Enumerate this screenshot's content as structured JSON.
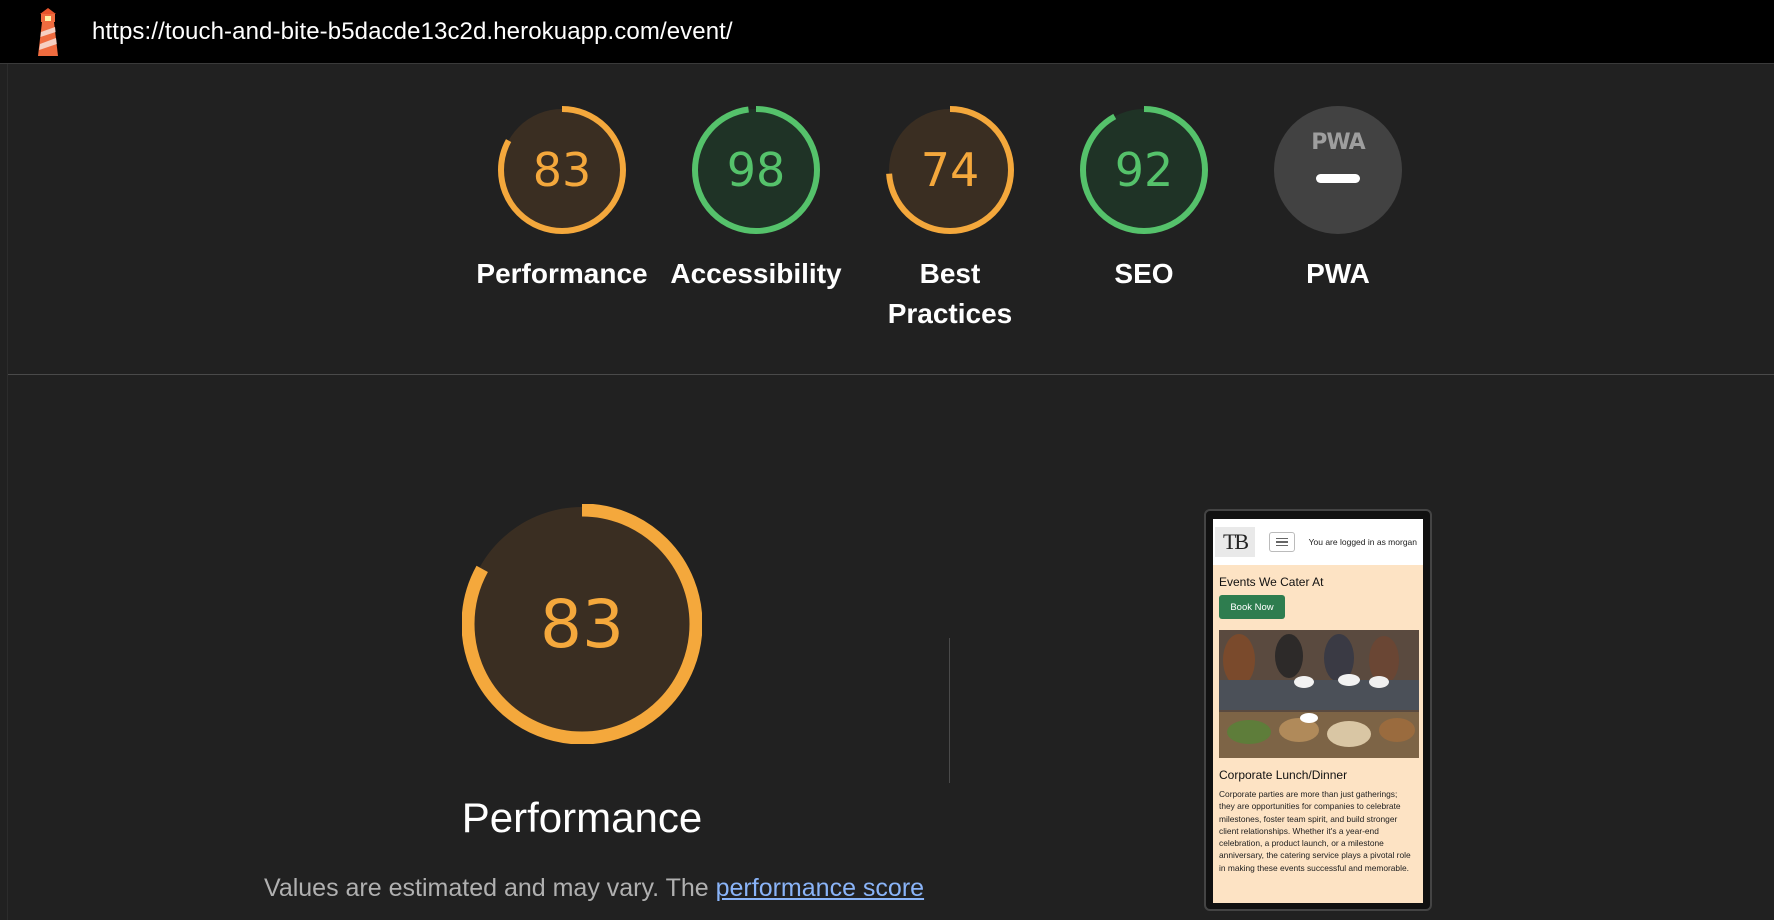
{
  "url": "https://touch-and-bite-b5dacde13c2d.herokuapp.com/event/",
  "colors": {
    "average": "#f4a83c",
    "pass": "#55c26b",
    "na": "#9e9e9e"
  },
  "categories": [
    {
      "label": "Performance",
      "score": 83,
      "status": "average"
    },
    {
      "label": "Accessibility",
      "score": 98,
      "status": "pass"
    },
    {
      "label": "Best Practices",
      "score": 74,
      "status": "average"
    },
    {
      "label": "SEO",
      "score": 92,
      "status": "pass"
    },
    {
      "label": "PWA",
      "score": null,
      "status": "na",
      "badge": "PWA"
    }
  ],
  "main": {
    "score": 83,
    "title": "Performance",
    "description": "Values are estimated and may vary. The",
    "link_text": "performance score"
  },
  "screenshot": {
    "logo": "TB",
    "logged_in": "You are logged in as morgan",
    "heading": "Events We Cater At",
    "button": "Book Now",
    "subheading": "Corporate Lunch/Dinner",
    "body": "Corporate parties are more than just gatherings; they are opportunities for companies to celebrate milestones, foster team spirit, and build stronger client relationships. Whether it's a year-end celebration, a product launch, or a milestone anniversary, the catering service plays a pivotal role in making these events successful and memorable."
  }
}
